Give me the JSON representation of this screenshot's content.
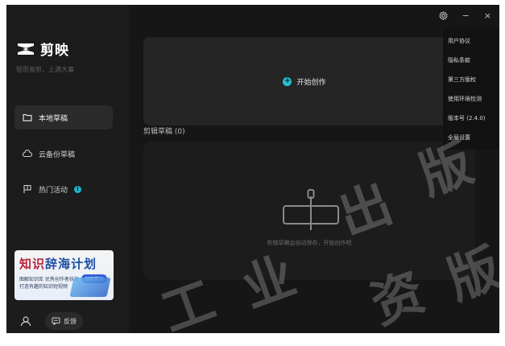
{
  "app": {
    "name": "剪映",
    "slogan": "轻而易剪，上满大事"
  },
  "sidebar": {
    "items": [
      {
        "label": "本地草稿",
        "icon": "folder-icon",
        "active": true
      },
      {
        "label": "云备份草稿",
        "icon": "cloud-icon",
        "active": false
      },
      {
        "label": "热门活动",
        "icon": "flag-icon",
        "badge": "!",
        "active": false
      }
    ],
    "banner": {
      "title_part1": "知识",
      "title_part2": "辞海计划",
      "line1": "图解知识库 优秀创作者扶持",
      "line2": "打造有趣的知识短视频",
      "tag": "领取奖励"
    },
    "feedback_label": "反馈"
  },
  "main": {
    "create_label": "开始创作",
    "drafts_title": "剪辑草稿 (0)",
    "empty_text": "剪辑草稿会自动保存，开始创作吧"
  },
  "titlebar": {
    "settings_icon": "gear-icon",
    "minimize": "−",
    "close": "×"
  },
  "menu": {
    "items": [
      "用户协议",
      "隐私条款",
      "第三方版权",
      "使用环境检测",
      "版本号 (2.4.0)",
      "全局设置"
    ]
  },
  "watermark": {
    "chars": [
      "工",
      "业",
      "出",
      "版",
      "资",
      "版"
    ]
  },
  "colors": {
    "accent": "#27c2d2",
    "background": "#141414",
    "sidebar": "#1c1c1c",
    "card": "#252525"
  }
}
